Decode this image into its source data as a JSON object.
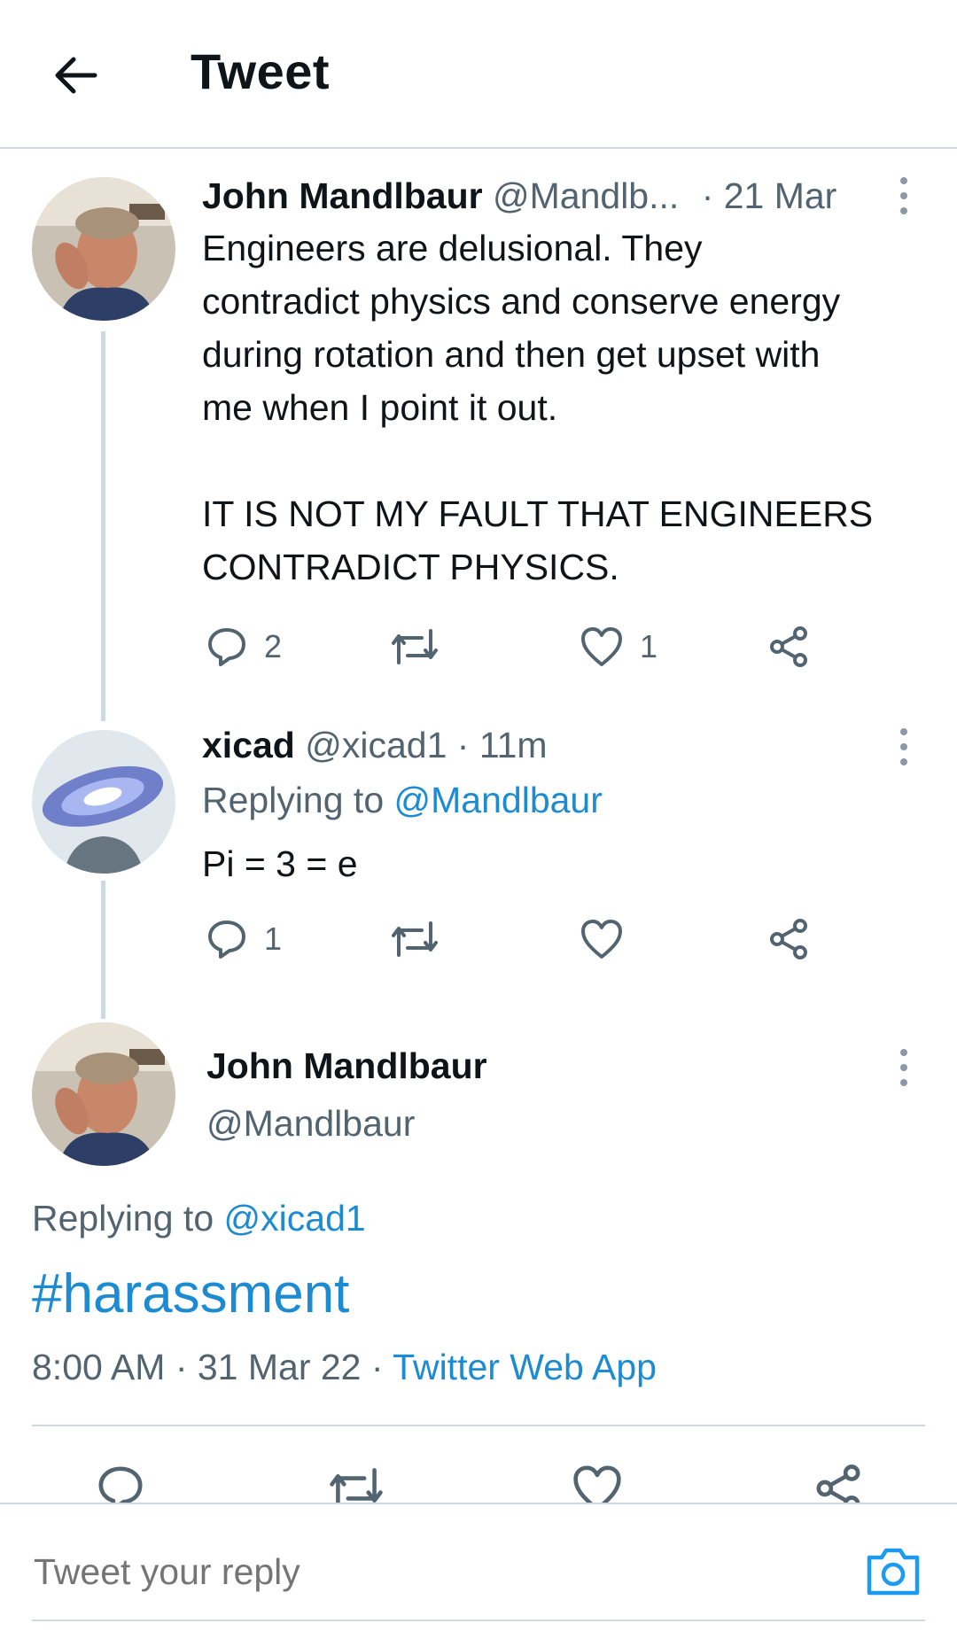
{
  "header": {
    "title": "Tweet"
  },
  "tweet1": {
    "name": "John Mandlbaur",
    "handle": "@Mandlb...",
    "time": "· 21 Mar",
    "text": "Engineers are delusional. They\ncontradict physics and conserve energy\nduring rotation and then get upset with\nme when I point it out.\n\nIT IS NOT MY FAULT THAT ENGINEERS\nCONTRADICT PHYSICS.",
    "replies": "2",
    "likes": "1"
  },
  "tweet2": {
    "name": "xicad",
    "handle": "@xicad1",
    "time": "· 11m",
    "replying_prefix": "Replying to",
    "replying_to": "@Mandlbaur",
    "text": "Pi = 3 = e",
    "replies": "1"
  },
  "main_tweet": {
    "name": "John Mandlbaur",
    "handle": "@Mandlbaur",
    "replying_prefix": "Replying to",
    "replying_to": "@xicad1",
    "text": "#harassment",
    "time": "8:00 AM · 31 Mar 22 ·",
    "source": "Twitter Web App"
  },
  "reply_bar": {
    "placeholder": "Tweet your reply"
  },
  "icons": {
    "back": "arrow-left-icon",
    "more": "more-vertical-icon",
    "reply": "reply-bubble-icon",
    "retweet": "retweet-icon",
    "like": "heart-icon",
    "share": "share-icon",
    "camera": "camera-icon"
  },
  "colors": {
    "accent": "#1d9bf0",
    "muted": "#536471",
    "border": "#cfd9de"
  }
}
